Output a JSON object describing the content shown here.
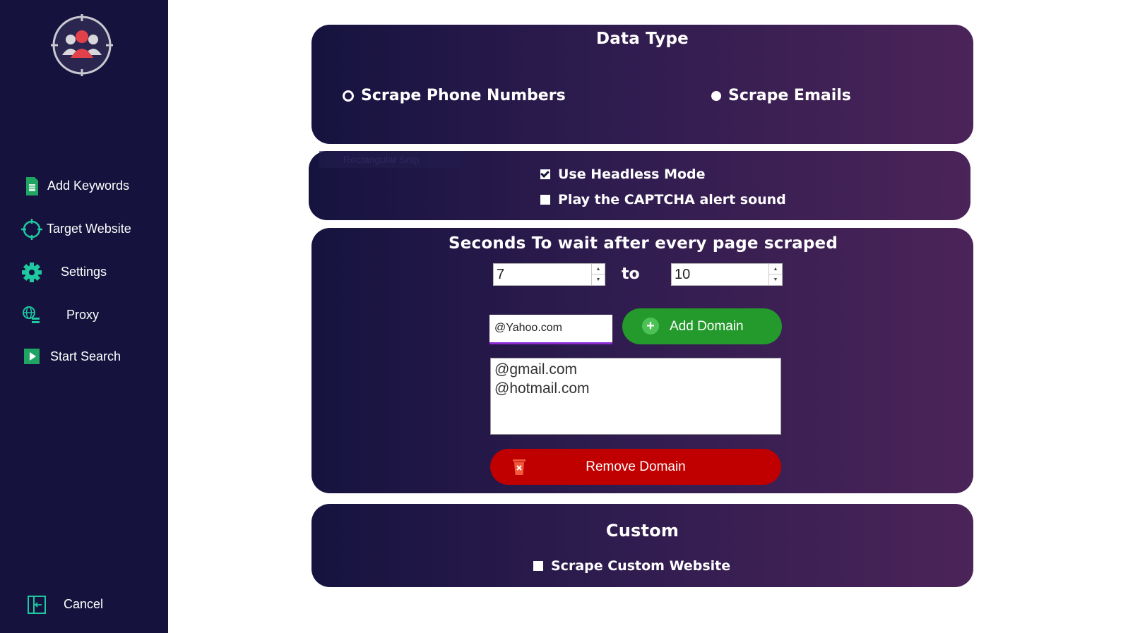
{
  "sidebar": {
    "logo_icon": "users-target-icon",
    "items": [
      {
        "label": "Add Keywords",
        "icon": "spreadsheet-icon"
      },
      {
        "label": "Target Website",
        "icon": "crosshair-icon"
      },
      {
        "label": "Settings",
        "icon": "gear-icon"
      },
      {
        "label": "Proxy",
        "icon": "proxy-network-icon"
      },
      {
        "label": "Start Search",
        "icon": "play-icon"
      }
    ],
    "cancel": {
      "label": "Cancel",
      "icon": "exit-icon"
    }
  },
  "data_type": {
    "title": "Data Type",
    "options": [
      {
        "label": "Scrape Phone Numbers",
        "selected": false
      },
      {
        "label": "Scrape Emails",
        "selected": true
      }
    ]
  },
  "options_panel": {
    "ghost_label": "Rectangular Snip",
    "headless": {
      "label": "Use Headless Mode",
      "checked": true
    },
    "captcha_sound": {
      "label": "Play the CAPTCHA alert sound",
      "checked": false
    }
  },
  "wait_panel": {
    "title": "Seconds To wait after every page scraped",
    "min_value": "7",
    "to_label": "to",
    "max_value": "10",
    "domain_input_value": "@Yahoo.com",
    "add_domain_label": "Add Domain",
    "domains": [
      "@gmail.com",
      "@hotmail.com"
    ],
    "remove_domain_label": "Remove Domain"
  },
  "custom_panel": {
    "title": "Custom",
    "custom_website": {
      "label": "Scrape Custom Website",
      "checked": false
    }
  },
  "colors": {
    "sidebar_bg": "#15123d",
    "accent_green": "#239a2b",
    "danger_red": "#c00000",
    "panel_gradient_start": "#16133f",
    "panel_gradient_end": "#4b2459"
  }
}
